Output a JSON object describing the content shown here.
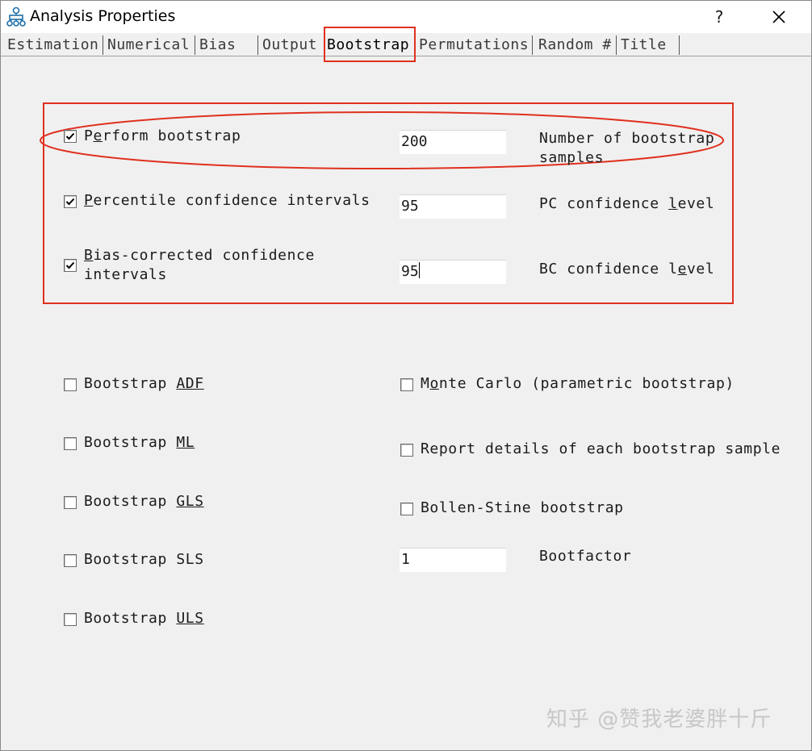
{
  "window": {
    "title": "Analysis Properties",
    "help_label": "?",
    "colors": {
      "annotation_red": "#e0301e",
      "background": "#f0f0f0"
    }
  },
  "tabs": [
    {
      "label": "Estimation"
    },
    {
      "label": "Numerical"
    },
    {
      "label": "Bias"
    },
    {
      "label": "Output"
    },
    {
      "label": "Bootstrap",
      "active": true
    },
    {
      "label": "Permutations"
    },
    {
      "label": "Random #"
    },
    {
      "label": "Title"
    }
  ],
  "bootstrap_options": {
    "perform": {
      "pre": "P",
      "ul": "e",
      "post": "rform bootstrap",
      "checked": true,
      "value": "200",
      "field_label": "Number of bootstrap samples"
    },
    "percentile": {
      "pre": "",
      "ul": "P",
      "post": "ercentile confidence intervals",
      "checked": true,
      "value": "95",
      "field_label_pre": "PC confidence ",
      "field_label_ul": "l",
      "field_label_post": "evel"
    },
    "bias_corrected": {
      "pre": "",
      "ul": "B",
      "post": "ias-corrected confidence intervals",
      "checked": true,
      "value": "95",
      "field_label_pre": "BC confidence l",
      "field_label_ul": "e",
      "field_label_post": "vel"
    }
  },
  "methods": [
    {
      "pre": "Bootstrap ",
      "ul": "ADF",
      "checked": false
    },
    {
      "pre": "Bootstrap ",
      "ul": "ML",
      "checked": false
    },
    {
      "pre": "Bootstrap ",
      "ul": "GLS",
      "checked": false
    },
    {
      "pre": "Bootstrap SLS",
      "ul": "",
      "checked": false
    },
    {
      "pre": "Bootstrap ",
      "ul": "ULS",
      "checked": false
    }
  ],
  "right_options": {
    "monte_carlo": {
      "pre": "M",
      "ul": "o",
      "post": "nte Carlo (parametric bootstrap)",
      "checked": false
    },
    "report_details": {
      "label": "Report details of each bootstrap sample",
      "checked": false
    },
    "bollen_stine": {
      "label": "Bollen-Stine bootstrap",
      "checked": false
    },
    "bootfactor": {
      "value": "1",
      "label": "Bootfactor"
    }
  },
  "watermark": "知乎 @赞我老婆胖十斤"
}
